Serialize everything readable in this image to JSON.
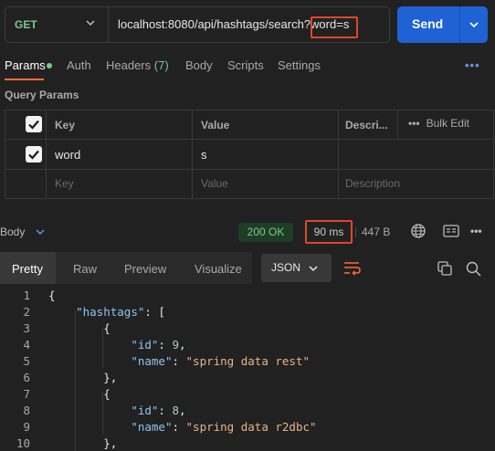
{
  "request": {
    "method": "GET",
    "url_base": "localhost:8080/api/hashtags/search?",
    "url_query": "word=s",
    "send_label": "Send"
  },
  "tabs": {
    "params": "Params",
    "auth": "Auth",
    "headers": "Headers",
    "headers_count": "(7)",
    "body": "Body",
    "scripts": "Scripts",
    "settings": "Settings",
    "more": "•••"
  },
  "query_params": {
    "title": "Query Params",
    "headers": {
      "key": "Key",
      "value": "Value",
      "description": "Descri...",
      "bulk_edit": "Bulk Edit"
    },
    "rows": [
      {
        "key": "word",
        "value": "s",
        "checked": true
      }
    ],
    "placeholders": {
      "key": "Key",
      "value": "Value",
      "description": "Description"
    }
  },
  "response": {
    "body_label": "Body",
    "status": "200 OK",
    "time": "90 ms",
    "size": "447 B",
    "views": [
      "Pretty",
      "Raw",
      "Preview",
      "Visualize"
    ],
    "active_view": "Pretty",
    "format": "JSON"
  },
  "code_lines": [
    {
      "n": "1",
      "text": "{"
    },
    {
      "n": "2",
      "text": "    \"hashtags\": ["
    },
    {
      "n": "3",
      "text": "        {"
    },
    {
      "n": "4",
      "text": "            \"id\": 9,"
    },
    {
      "n": "5",
      "text": "            \"name\": \"spring data rest\""
    },
    {
      "n": "6",
      "text": "        },"
    },
    {
      "n": "7",
      "text": "        {"
    },
    {
      "n": "8",
      "text": "            \"id\": 8,"
    },
    {
      "n": "9",
      "text": "            \"name\": \"spring data r2dbc\""
    },
    {
      "n": "10",
      "text": "        },"
    }
  ],
  "colors": {
    "background": "#212121",
    "send_button": "#1f62d6",
    "method_get": "#79c98b",
    "active_tab_underline": "#ff6c37",
    "highlight_box": "#e2452b",
    "status_ok": "#79c98b",
    "json_key": "#8cc4f3",
    "json_string": "#e8b38a"
  },
  "icons": {
    "method_dropdown": "chevron-down-icon",
    "send_dropdown": "chevron-down-icon",
    "bulk_edit": "ellipsis-icon",
    "body_dropdown": "chevron-down-icon",
    "globe": "globe-icon",
    "save_response": "save-response-icon",
    "response_more": "more-horizontal-icon",
    "wrap": "wrap-lines-icon",
    "copy": "copy-icon",
    "search": "search-icon"
  }
}
